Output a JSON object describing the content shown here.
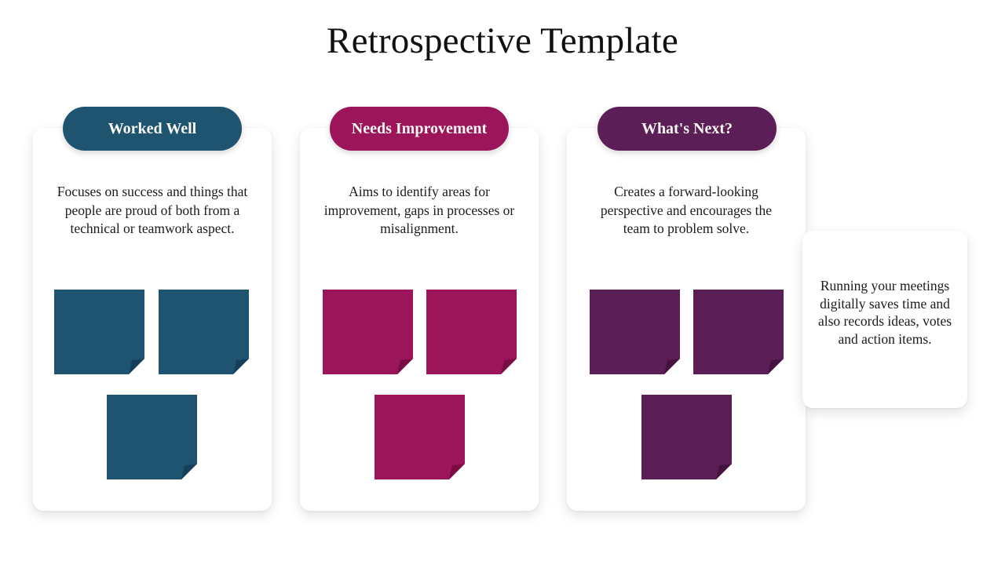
{
  "slide": {
    "title": "Retrospective Template",
    "background_color": "#ffffff"
  },
  "colors": {
    "teal": "#1f5471",
    "teal_fold": "#16405a",
    "magenta": "#9c1459",
    "magenta_fold": "#7a0c44",
    "purple": "#5c1e57",
    "purple_fold": "#451241",
    "card_background": "#ffffff",
    "title_text": "#111111",
    "body_text": "#1b1b1b",
    "pill_text": "#fbf7f4"
  },
  "columns": [
    {
      "id": "worked-well",
      "header": "Worked Well",
      "header_color": "#1f5471",
      "description": "Focuses on success and things that people are proud of both from a technical or teamwork aspect.",
      "note_color": "#1f5471",
      "note_fold_color": "#16405a",
      "note_count": 3
    },
    {
      "id": "needs-improvement",
      "header": "Needs Improvement",
      "header_color": "#9c1459",
      "description": "Aims to identify areas for improvement, gaps in processes or misalignment.",
      "note_color": "#9c1459",
      "note_fold_color": "#7a0c44",
      "note_count": 3
    },
    {
      "id": "whats-next",
      "header": "What's Next?",
      "header_color": "#5c1e57",
      "description": "Creates a forward-looking perspective and encourages the team to problem solve.",
      "note_color": "#5c1e57",
      "note_fold_color": "#451241",
      "note_count": 3
    }
  ],
  "side_note": {
    "text": "Running your meetings digitally saves time and also records ideas, votes and action items."
  }
}
